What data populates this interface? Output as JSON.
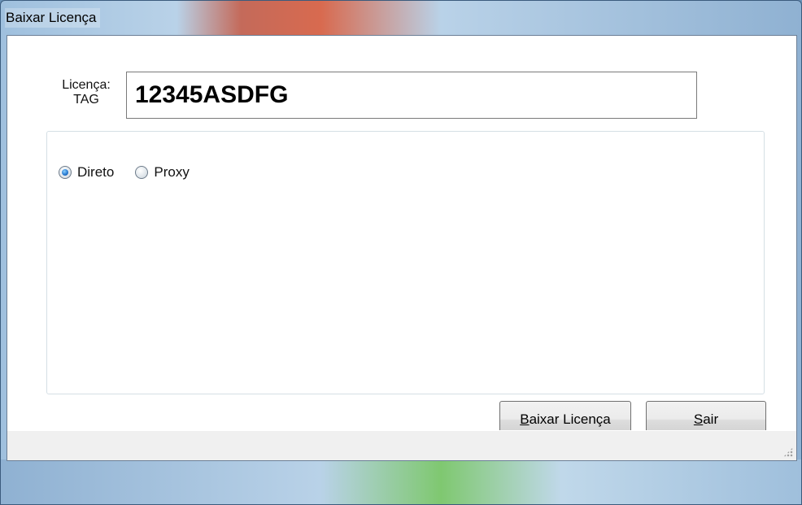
{
  "window": {
    "title": "Baixar Licença"
  },
  "license": {
    "label_line1": "Licença:",
    "label_line2": "TAG",
    "value": "12345ASDFG"
  },
  "connection": {
    "options": [
      {
        "label": "Direto",
        "checked": true
      },
      {
        "label": "Proxy",
        "checked": false
      }
    ]
  },
  "buttons": {
    "download": {
      "mnemonic": "B",
      "rest": "aixar Licença"
    },
    "exit": {
      "mnemonic": "S",
      "rest": "air"
    }
  }
}
